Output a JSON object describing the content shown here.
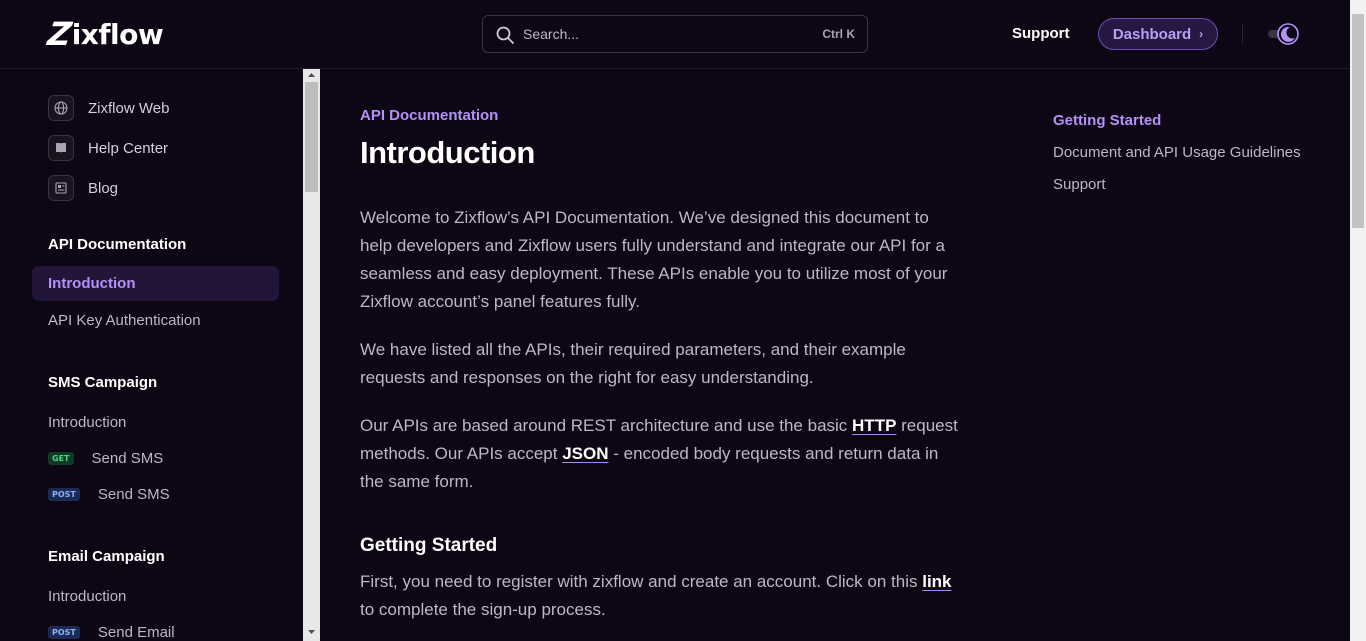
{
  "header": {
    "logo_text": "ixflow",
    "logo_mark": "Z",
    "search_placeholder": "Search...",
    "search_shortcut": "Ctrl K",
    "support_label": "Support",
    "dashboard_label": "Dashboard"
  },
  "sidebar": {
    "links": [
      {
        "label": "Zixflow Web",
        "icon": "globe-icon"
      },
      {
        "label": "Help Center",
        "icon": "book-icon"
      },
      {
        "label": "Blog",
        "icon": "newspaper-icon"
      }
    ],
    "sections": [
      {
        "title": "API Documentation",
        "items": [
          {
            "label": "Introduction",
            "active": true
          },
          {
            "label": "API Key Authentication"
          }
        ]
      },
      {
        "title": "SMS Campaign",
        "items": [
          {
            "label": "Introduction"
          },
          {
            "label": "Send SMS",
            "method": "GET"
          },
          {
            "label": "Send SMS",
            "method": "POST"
          }
        ]
      },
      {
        "title": "Email Campaign",
        "items": [
          {
            "label": "Introduction"
          },
          {
            "label": "Send Email",
            "method": "POST"
          }
        ]
      }
    ]
  },
  "main": {
    "eyebrow": "API Documentation",
    "title": "Introduction",
    "p1": "Welcome to Zixflow’s API Documentation. We’ve designed this document to help developers and Zixflow users fully understand and integrate our API for a seamless and easy deployment. These APIs enable you to utilize most of your Zixflow account’s panel features fully.",
    "p2": "We have listed all the APIs, their required parameters, and their example requests and responses on the right for easy understanding.",
    "p3_a": "Our APIs are based around REST architecture and use the basic ",
    "p3_link1": "HTTP",
    "p3_b": " request methods. Our APIs accept ",
    "p3_link2": "JSON",
    "p3_c": " - encoded body requests and return data in the same form.",
    "h2": "Getting Started",
    "p4_a": "First, you need to register with zixflow and create an account. Click on this ",
    "p4_link": "link",
    "p4_b": " to complete the sign-up process."
  },
  "toc": {
    "items": [
      {
        "label": "Getting Started",
        "active": true
      },
      {
        "label": "Document and API Usage Guidelines"
      },
      {
        "label": "Support"
      }
    ]
  },
  "colors": {
    "background": "#0d0614",
    "accent": "#b491f8",
    "get_badge": "#46d58a",
    "post_badge": "#8fb0ff"
  }
}
